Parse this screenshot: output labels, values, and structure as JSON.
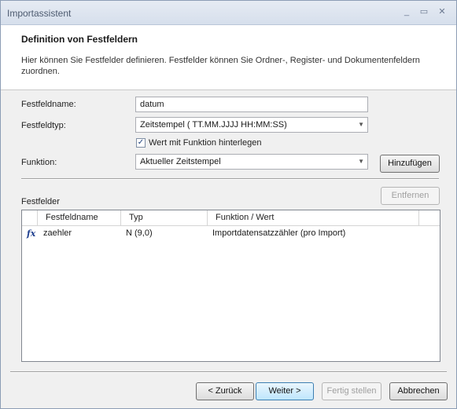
{
  "window": {
    "title": "Importassistent"
  },
  "header": {
    "title": "Definition von Festfeldern",
    "description": "Hier können Sie Festfelder definieren. Festfelder können Sie Ordner-, Register- und Dokumentenfeldern zuordnen."
  },
  "form": {
    "festfeldname_label": "Festfeldname:",
    "festfeldname_value": "datum",
    "festfeldtyp_label": "Festfeldtyp:",
    "festfeldtyp_value": "Zeitstempel ( TT.MM.JJJJ HH:MM:SS)",
    "checkbox_label": "Wert mit Funktion hinterlegen",
    "checkbox_checked": true,
    "funktion_label": "Funktion:",
    "funktion_value": "Aktueller Zeitstempel",
    "add_button": "Hinzufügen"
  },
  "festfelder": {
    "label": "Festfelder",
    "remove_button": "Entfernen",
    "columns": [
      "Festfeldname",
      "Typ",
      "Funktion / Wert"
    ],
    "rows": [
      {
        "icon": "function-icon",
        "name": "zaehler",
        "typ": "N (9,0)",
        "funktion": "Importdatensatzzähler (pro Import)"
      }
    ]
  },
  "footer": {
    "back": "< Zurück",
    "next": "Weiter >",
    "finish": "Fertig stellen",
    "cancel": "Abbrechen"
  }
}
